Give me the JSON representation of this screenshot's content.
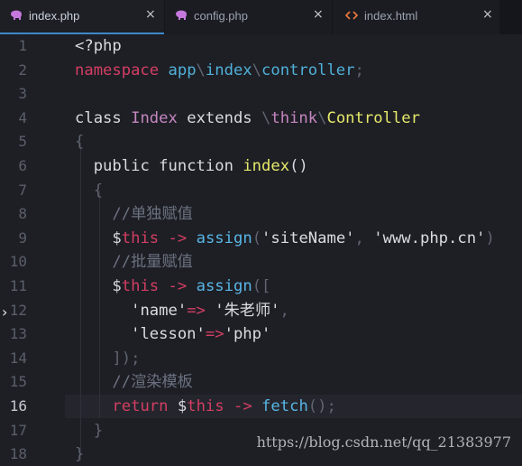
{
  "tabs": [
    {
      "icon": "php-elephant-icon",
      "label": "index.php",
      "close": "×",
      "active": true
    },
    {
      "icon": "php-elephant-icon",
      "label": "config.php",
      "close": "×",
      "active": false
    },
    {
      "icon": "code-brackets-icon",
      "label": "index.html",
      "close": "×",
      "active": false
    }
  ],
  "colors": {
    "tab_accent": "#3e88c9",
    "keyword": "#d33e63",
    "identifier": "#4fb0d8",
    "class_name": "#c586c0",
    "parent_class": "#e6e96a",
    "comment": "#6b7180",
    "icon_php": "#c678dd",
    "icon_html": "#e5743b"
  },
  "gutter": {
    "lines": [
      "1",
      "2",
      "3",
      "4",
      "5",
      "6",
      "7",
      "8",
      "9",
      "10",
      "11",
      "12",
      "13",
      "14",
      "15",
      "16",
      "17",
      "18"
    ],
    "current_line": "16"
  },
  "code": {
    "l1": {
      "text": "<?php"
    },
    "l2": {
      "t1": "namespace",
      "t2": "app",
      "t3": "\\",
      "t4": "index",
      "t5": "\\",
      "t6": "controller",
      "t7": ";"
    },
    "l4": {
      "t1": "class",
      "t2": "Index",
      "t3": "extends",
      "t4": "\\",
      "t5": "think",
      "t6": "\\",
      "t7": "Controller"
    },
    "l5": {
      "t1": "{"
    },
    "l6": {
      "t1": "public",
      "t2": "function",
      "t3": "index",
      "t4": "()"
    },
    "l7": {
      "t1": "{"
    },
    "l8": {
      "t1": "//单独赋值"
    },
    "l9": {
      "t1": "$",
      "t2": "this",
      "t3": "->",
      "t4": "assign",
      "t5": "(",
      "t6": "'siteName'",
      "t7": ",",
      "t8": "'www.php.cn'",
      "t9": ")"
    },
    "l10": {
      "t1": "//批量赋值"
    },
    "l11": {
      "t1": "$",
      "t2": "this",
      "t3": "->",
      "t4": "assign",
      "t5": "(["
    },
    "l12": {
      "t1": "'name'",
      "t2": "=>",
      "t3": "'朱老师'",
      "t4": ","
    },
    "l13": {
      "t1": "'lesson'",
      "t2": "=>",
      "t3": "'php'"
    },
    "l14": {
      "t1": "]);"
    },
    "l15": {
      "t1": "//渲染模板"
    },
    "l16": {
      "t1": "return",
      "t2": "$",
      "t3": "this",
      "t4": "->",
      "t5": "fetch",
      "t6": "();"
    },
    "l17": {
      "t1": "}"
    },
    "l18": {
      "t1": "}"
    }
  },
  "fold_arrow": "›",
  "watermark": "https://blog.csdn.net/qq_21383977"
}
